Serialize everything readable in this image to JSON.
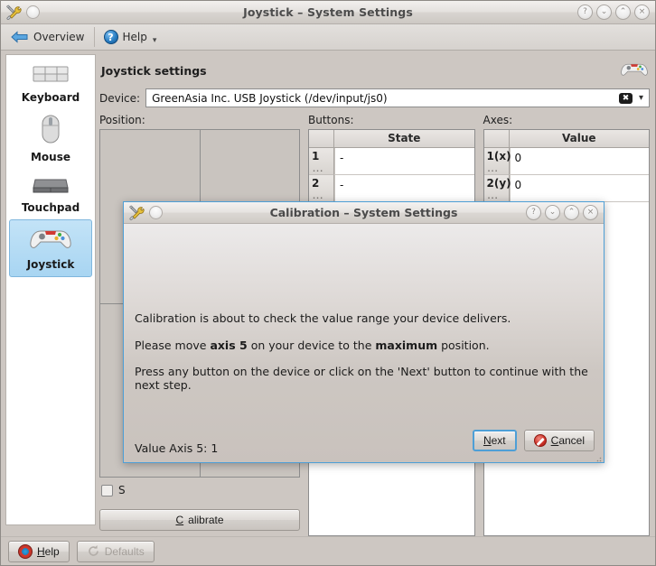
{
  "window": {
    "title": "Joystick – System Settings",
    "titlebar_buttons": [
      {
        "name": "help-titlebar-button",
        "glyph": "?"
      },
      {
        "name": "minimize-button",
        "glyph": "⌄"
      },
      {
        "name": "maximize-button",
        "glyph": "⌃"
      },
      {
        "name": "close-button",
        "glyph": "×"
      }
    ],
    "menu_icon": "tools-icon",
    "menu_circle": "window-menu-button"
  },
  "toolbar": {
    "overview_label": "Overview",
    "help_label": "Help",
    "back_icon": "back-arrow-icon",
    "help_icon": "help-question-icon",
    "more_icon": "chevron-down-icon"
  },
  "sidebar": {
    "items": [
      {
        "label": "Keyboard",
        "icon": "keyboard-icon",
        "selected": false
      },
      {
        "label": "Mouse",
        "icon": "mouse-icon",
        "selected": false
      },
      {
        "label": "Touchpad",
        "icon": "touchpad-icon",
        "selected": false
      },
      {
        "label": "Joystick",
        "icon": "gamepad-icon",
        "selected": true
      }
    ]
  },
  "main": {
    "panel_title": "Joystick settings",
    "panel_icon": "gamepad-icon",
    "device_label": "Device:",
    "device_value": "GreenAsia Inc.   USB  Joystick  (/dev/input/js0)",
    "device_clear_icon": "clear-icon",
    "device_chevron_icon": "chevron-down-icon",
    "position_label": "Position:",
    "buttons_label": "Buttons:",
    "axes_label": "Axes:",
    "trace_checkbox_label": "S",
    "calibrate_label": "Calibrate",
    "calibrate_accel": "C",
    "buttons_table": {
      "header": "State",
      "rows": [
        {
          "index": "1",
          "value": "-"
        },
        {
          "index": "2",
          "value": "-"
        },
        {
          "index": "",
          "value": ""
        }
      ]
    },
    "axes_table": {
      "header": "Value",
      "rows": [
        {
          "index": "1(x)",
          "value": "0"
        },
        {
          "index": "2(y)",
          "value": "0"
        },
        {
          "index": "",
          "value": ""
        }
      ]
    }
  },
  "statusbar": {
    "help_label": "Help",
    "help_accel": "H",
    "help_icon": "lifebuoy-icon",
    "defaults_label": "Defaults",
    "defaults_icon": "refresh-icon",
    "defaults_disabled": true
  },
  "dialog": {
    "title": "Calibration – System Settings",
    "menu_icon": "tools-icon",
    "menu_circle": "window-menu-button",
    "titlebar_buttons": [
      {
        "name": "help-titlebar-button",
        "glyph": "?"
      },
      {
        "name": "minimize-button",
        "glyph": "⌄"
      },
      {
        "name": "maximize-button",
        "glyph": "⌃"
      },
      {
        "name": "close-button",
        "glyph": "×"
      }
    ],
    "line1": "Calibration is about to check the value range your device delivers.",
    "line2_pre": "Please move ",
    "line2_bold1": "axis 5",
    "line2_mid": " on your device to the ",
    "line2_bold2": "maximum",
    "line2_post": " position.",
    "line3": "Press any button on the device or click on the 'Next' button to continue with the next step.",
    "value_text": "Value Axis 5: 1",
    "next_label": "Next",
    "next_accel": "N",
    "cancel_label": "Cancel",
    "cancel_accel": "C",
    "cancel_icon": "cancel-icon"
  },
  "colors": {
    "accent": "#4e9fd6",
    "window_bg": "#cdc7c2",
    "selection": "#a8d5f2"
  }
}
